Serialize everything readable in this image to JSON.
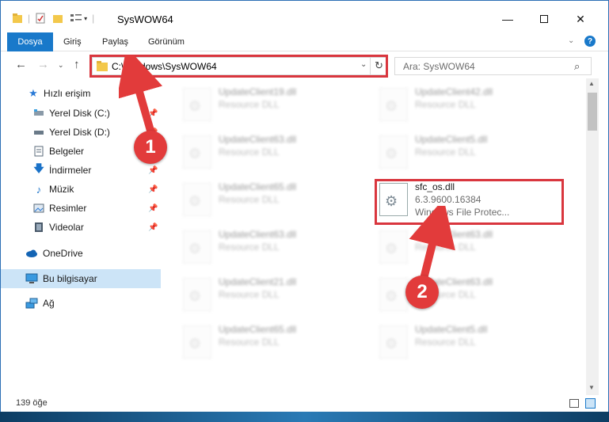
{
  "window": {
    "title": "SysWOW64"
  },
  "ribbon": {
    "tabs": [
      "Dosya",
      "Giriş",
      "Paylaş",
      "Görünüm"
    ]
  },
  "address": {
    "path": "C:\\Windows\\SysWOW64"
  },
  "search": {
    "placeholder": "Ara: SysWOW64"
  },
  "sidebar": {
    "items": [
      {
        "label": "Hızlı erişim",
        "icon": "star-icon"
      },
      {
        "label": "Yerel Disk (C:)",
        "icon": "drive-icon"
      },
      {
        "label": "Yerel Disk (D:)",
        "icon": "drive-icon"
      },
      {
        "label": "Belgeler",
        "icon": "documents-icon"
      },
      {
        "label": "İndirmeler",
        "icon": "downloads-icon"
      },
      {
        "label": "Müzik",
        "icon": "music-icon"
      },
      {
        "label": "Resimler",
        "icon": "pictures-icon"
      },
      {
        "label": "Videolar",
        "icon": "videos-icon"
      },
      {
        "label": "OneDrive",
        "icon": "cloud-icon"
      },
      {
        "label": "Bu bilgisayar",
        "icon": "computer-icon"
      },
      {
        "label": "Ağ",
        "icon": "network-icon"
      }
    ]
  },
  "files": [
    {
      "name": "UpdateClient19.dll",
      "type": "Resource DLL"
    },
    {
      "name": "UpdateClient42.dll",
      "type": "Resource DLL"
    },
    {
      "name": "UpdateClient63.dll",
      "type": "Resource DLL"
    },
    {
      "name": "UpdateClient5.dll",
      "type": "Resource DLL"
    },
    {
      "name": "UpdateClient65.dll",
      "type": "Resource DLL"
    },
    {
      "name": "sfc_os.dll",
      "version": "6.3.9600.16384",
      "type": "Windows File Protec..."
    },
    {
      "name": "UpdateClient63.dll",
      "type": "Resource DLL"
    },
    {
      "name": "UpdateClient63.dll",
      "type": "Resource DLL"
    },
    {
      "name": "UpdateClient21.dll",
      "type": "Resource DLL"
    },
    {
      "name": "UpdateClient63.dll",
      "type": "Resource DLL"
    },
    {
      "name": "UpdateClient65.dll",
      "type": "Resource DLL"
    },
    {
      "name": "UpdateClient5.dll",
      "type": "Resource DLL"
    }
  ],
  "status": {
    "count": "139 öğe"
  },
  "annotations": {
    "step1": "1",
    "step2": "2",
    "color": "#e23b3b"
  }
}
